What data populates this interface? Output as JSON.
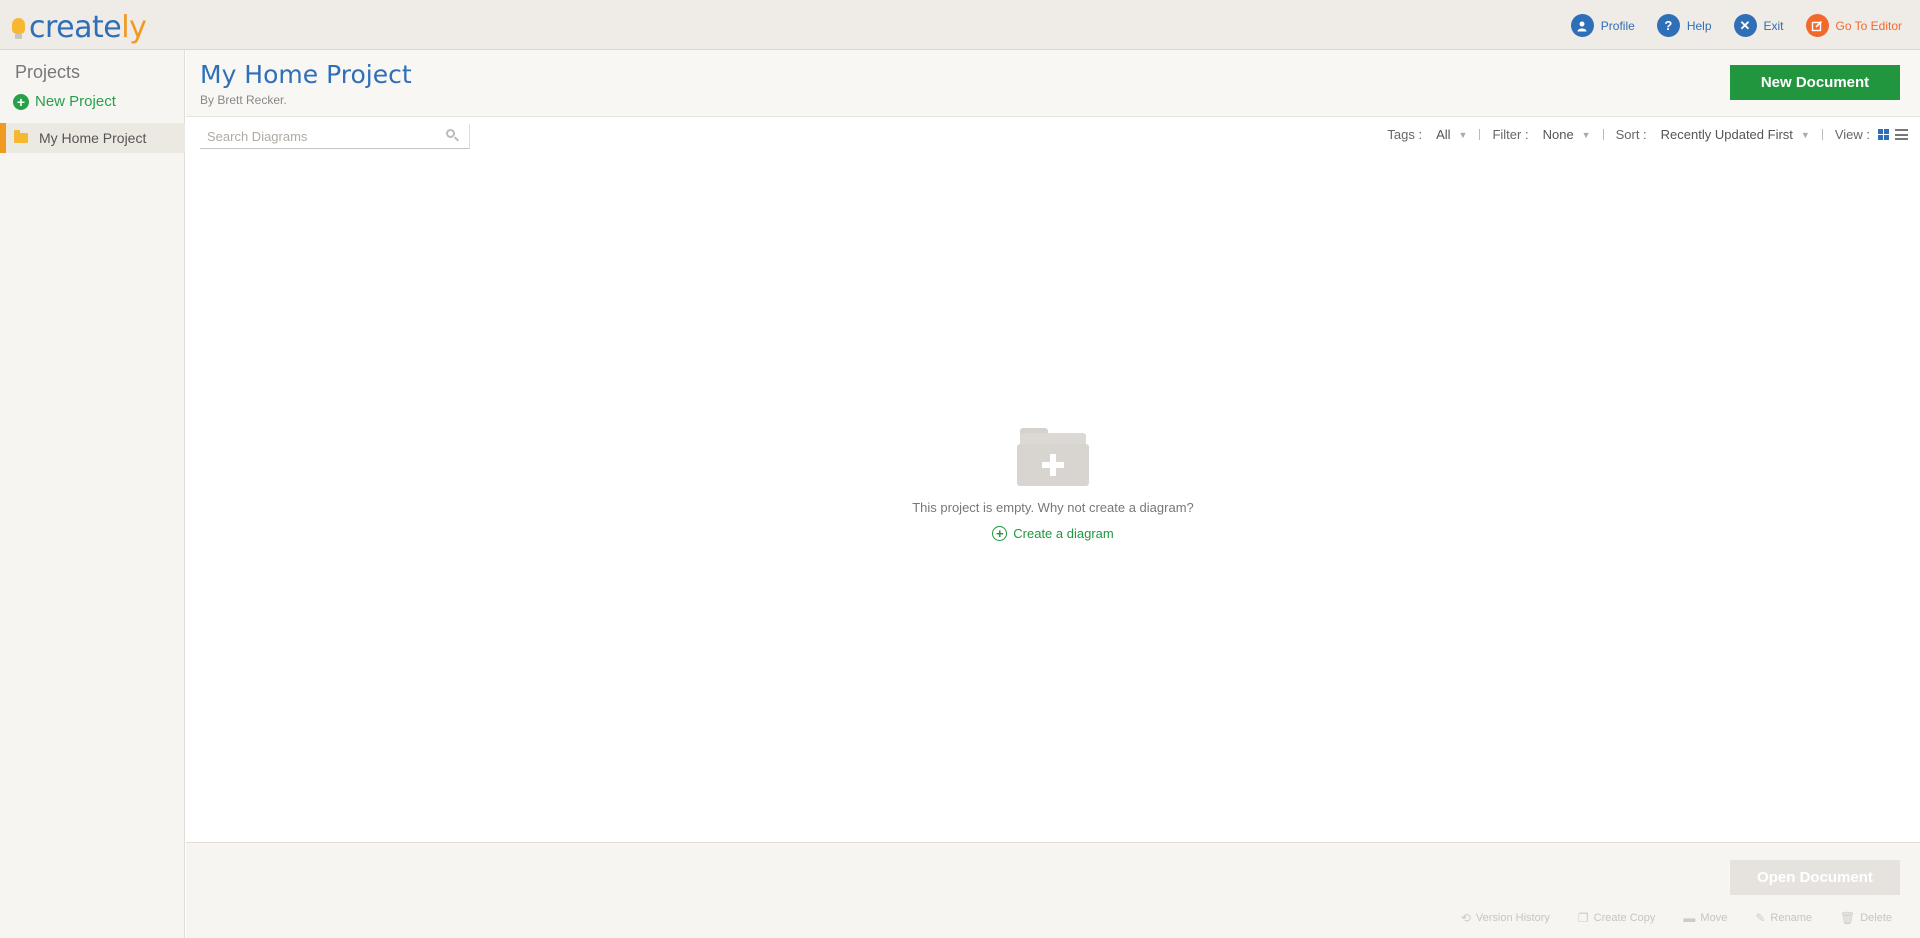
{
  "app": {
    "logo_text_main": "create",
    "logo_text_accent": "ly"
  },
  "topnav": {
    "profile": "Profile",
    "help": "Help",
    "exit": "Exit",
    "go_to_editor": "Go To Editor"
  },
  "sidebar": {
    "title": "Projects",
    "new_project": "New Project",
    "projects": [
      {
        "label": "My Home Project",
        "selected": true
      }
    ]
  },
  "header": {
    "title": "My Home Project",
    "byline": "By Brett Recker.",
    "new_document": "New Document"
  },
  "toolbar": {
    "search_placeholder": "Search Diagrams",
    "tags_label": "Tags :",
    "tags_value": "All",
    "filter_label": "Filter :",
    "filter_value": "None",
    "sort_label": "Sort :",
    "sort_value": "Recently Updated First",
    "view_label": "View :",
    "active_view": "grid"
  },
  "empty_state": {
    "message": "This project is empty. Why not create a diagram?",
    "create_link": "Create a diagram"
  },
  "footer": {
    "open_document": "Open Document",
    "actions": {
      "version_history": "Version History",
      "create_copy": "Create Copy",
      "move": "Move",
      "rename": "Rename",
      "delete": "Delete"
    }
  },
  "colors": {
    "brand_blue": "#2f6fb7",
    "brand_orange": "#f19a22",
    "primary_green": "#22963f",
    "editor_orange": "#f26a2b"
  }
}
